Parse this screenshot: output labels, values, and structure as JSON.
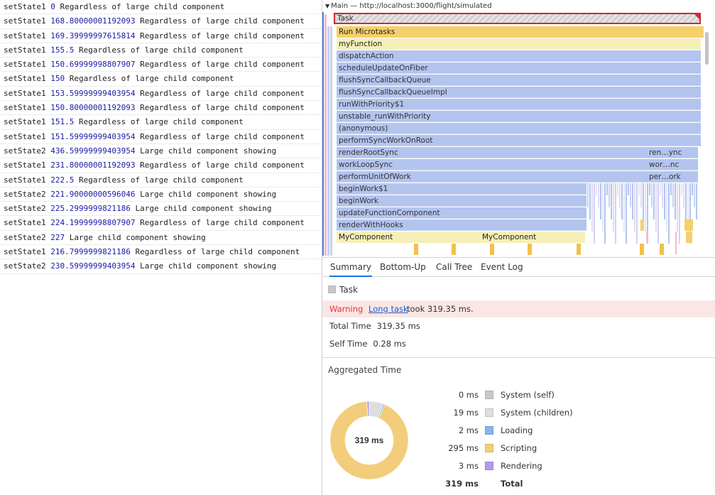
{
  "console": {
    "rows": [
      {
        "fn": "setState1",
        "num": "0",
        "msg": "Regardless of large child component"
      },
      {
        "fn": "setState1",
        "num": "168.80000001192093",
        "msg": "Regardless of large child component"
      },
      {
        "fn": "setState1",
        "num": "169.39999997615814",
        "msg": "Regardless of large child component"
      },
      {
        "fn": "setState1",
        "num": "155.5",
        "msg": "Regardless of large child component"
      },
      {
        "fn": "setState1",
        "num": "150.69999998807907",
        "msg": "Regardless of large child component"
      },
      {
        "fn": "setState1",
        "num": "150",
        "msg": "Regardless of large child component"
      },
      {
        "fn": "setState1",
        "num": "153.59999999403954",
        "msg": "Regardless of large child component"
      },
      {
        "fn": "setState1",
        "num": "150.80000001192093",
        "msg": "Regardless of large child component"
      },
      {
        "fn": "setState1",
        "num": "151.5",
        "msg": "Regardless of large child component"
      },
      {
        "fn": "setState1",
        "num": "151.59999999403954",
        "msg": "Regardless of large child component"
      },
      {
        "fn": "setState2",
        "num": "436.59999999403954",
        "msg": "Large child component showing"
      },
      {
        "fn": "setState1",
        "num": "231.80000001192093",
        "msg": "Regardless of large child component"
      },
      {
        "fn": "setState1",
        "num": "222.5",
        "msg": "Regardless of large child component"
      },
      {
        "fn": "setState2",
        "num": "221.90000000596046",
        "msg": "Large child component showing"
      },
      {
        "fn": "setState2",
        "num": "225.2999999821186",
        "msg": "Large child component showing"
      },
      {
        "fn": "setState1",
        "num": "224.19999998807907",
        "msg": "Regardless of large child component"
      },
      {
        "fn": "setState2",
        "num": "227",
        "msg": "Large child component showing"
      },
      {
        "fn": "setState1",
        "num": "216.7999999821186",
        "msg": "Regardless of large child component"
      },
      {
        "fn": "setState2",
        "num": "230.59999999403954",
        "msg": "Large child component showing"
      }
    ]
  },
  "flamechart": {
    "track_title": "Main — http://localhost:3000/flight/simulated",
    "task_label": "Task",
    "stack": [
      "Run Microtasks",
      "myFunction",
      "dispatchAction",
      "scheduleUpdateOnFiber",
      "flushSyncCallbackQueue",
      "flushSyncCallbackQueueImpl",
      "runWithPriority$1",
      "unstable_runWithPriority",
      "(anonymous)",
      "performSyncWorkOnRoot",
      "renderRootSync",
      "workLoopSync",
      "performUnitOfWork",
      "beginWork$1",
      "beginWork",
      "updateFunctionComponent",
      "renderWithHooks"
    ],
    "side_labels": [
      "ren…ync",
      "wor…nc",
      "per…ork"
    ],
    "component_label_1": "MyComponent",
    "component_label_2": "MyComponent"
  },
  "tabs": [
    {
      "label": "Summary"
    },
    {
      "label": "Bottom-Up"
    },
    {
      "label": "Call Tree"
    },
    {
      "label": "Event Log"
    }
  ],
  "summary": {
    "title": "Task",
    "warning_label": "Warning",
    "warning_link": "Long task",
    "warning_text": "took 319.35 ms.",
    "total_time_label": "Total Time",
    "total_time_value": "319.35 ms",
    "self_time_label": "Self Time",
    "self_time_value": "0.28 ms",
    "aggregated_title": "Aggregated Time",
    "donut_center": "319 ms",
    "legend": [
      {
        "ms": "0 ms",
        "label": "System (self)",
        "value": 0.28,
        "color": "#c8c8c8",
        "border": "#b0b0b0"
      },
      {
        "ms": "19 ms",
        "label": "System (children)",
        "value": 19,
        "color": "#dedede",
        "border": "#c4c4c4"
      },
      {
        "ms": "2 ms",
        "label": "Loading",
        "value": 2,
        "color": "#8db4e8",
        "border": "#6e9ed8"
      },
      {
        "ms": "295 ms",
        "label": "Scripting",
        "value": 295,
        "color": "#f2cd7c",
        "border": "#ddb560"
      },
      {
        "ms": "3 ms",
        "label": "Rendering",
        "value": 3,
        "color": "#b49ce8",
        "border": "#9c82d6"
      }
    ],
    "total_ms": "319 ms",
    "total_label": "Total"
  },
  "colors": {
    "task_border": "#d5262e",
    "tab_active": "#1a73e8",
    "warning_bg": "#fbe6e6",
    "console_number": "#1a1aa6"
  }
}
